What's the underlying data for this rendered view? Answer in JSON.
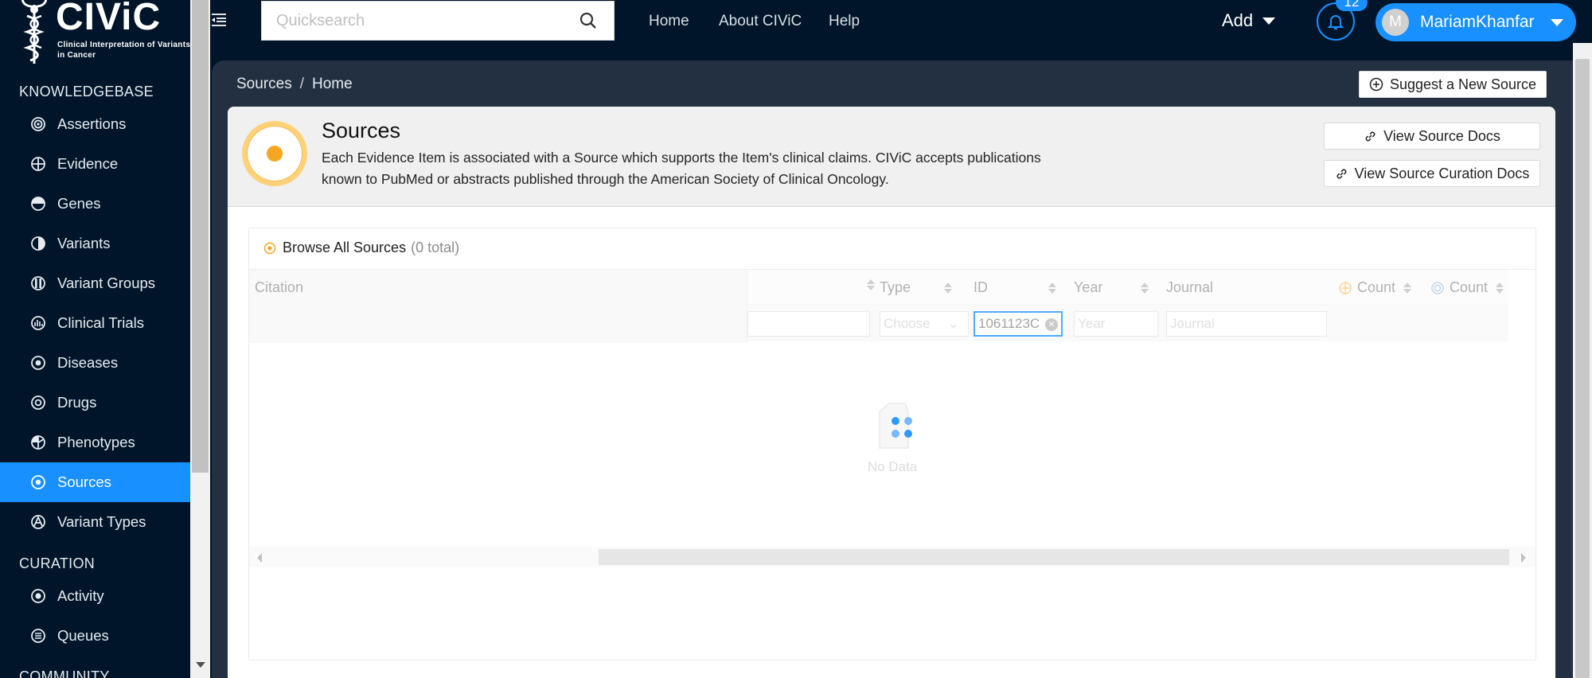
{
  "app": {
    "logo_text": "CIViC",
    "logo_subtitle": "Clinical Interpretation of Variants in Cancer"
  },
  "sidebar": {
    "sections": [
      {
        "title": "KNOWLEDGEBASE",
        "items": [
          {
            "label": "Assertions",
            "icon": "assertion-icon"
          },
          {
            "label": "Evidence",
            "icon": "evidence-icon"
          },
          {
            "label": "Genes",
            "icon": "gene-icon"
          },
          {
            "label": "Variants",
            "icon": "variant-icon"
          },
          {
            "label": "Variant Groups",
            "icon": "variant-group-icon"
          },
          {
            "label": "Clinical Trials",
            "icon": "clinical-trial-icon"
          },
          {
            "label": "Diseases",
            "icon": "disease-icon"
          },
          {
            "label": "Drugs",
            "icon": "drug-icon"
          },
          {
            "label": "Phenotypes",
            "icon": "phenotype-icon"
          },
          {
            "label": "Sources",
            "icon": "source-icon",
            "active": true
          },
          {
            "label": "Variant Types",
            "icon": "variant-type-icon"
          }
        ]
      },
      {
        "title": "CURATION",
        "items": [
          {
            "label": "Activity",
            "icon": "activity-icon"
          },
          {
            "label": "Queues",
            "icon": "queue-icon"
          }
        ]
      },
      {
        "title": "COMMUNITY",
        "items": []
      }
    ]
  },
  "header": {
    "search_placeholder": "Quicksearch",
    "links": [
      "Home",
      "About CIViC",
      "Help"
    ],
    "add_label": "Add",
    "notification_count": "12",
    "user_initial": "M",
    "user_name": "MariamKhanfar"
  },
  "breadcrumb": [
    "Sources",
    "Home"
  ],
  "actions": {
    "suggest_label": "Suggest a New Source",
    "view_docs_label": "View Source Docs",
    "view_curation_docs_label": "View Source Curation Docs"
  },
  "page": {
    "title": "Sources",
    "description": "Each Evidence Item is associated with a Source which supports the Item's clinical claims. CIViC accepts publications known to PubMed or abstracts published through the American Society of Clinical Oncology.",
    "accent_color": "#f5a623"
  },
  "browse": {
    "title": "Browse All Sources",
    "count_text": "(0 total)",
    "columns": [
      "Citation",
      "Type",
      "ID",
      "Year",
      "Journal",
      "Count",
      "Count"
    ],
    "filters": {
      "type_placeholder": "Choose",
      "id_value": "1061123C",
      "year_placeholder": "Year",
      "journal_placeholder": "Journal"
    },
    "empty_text": "No Data"
  },
  "colors": {
    "sidebar_bg": "#001529",
    "active": "#1890ff",
    "content_bg": "#233041"
  }
}
